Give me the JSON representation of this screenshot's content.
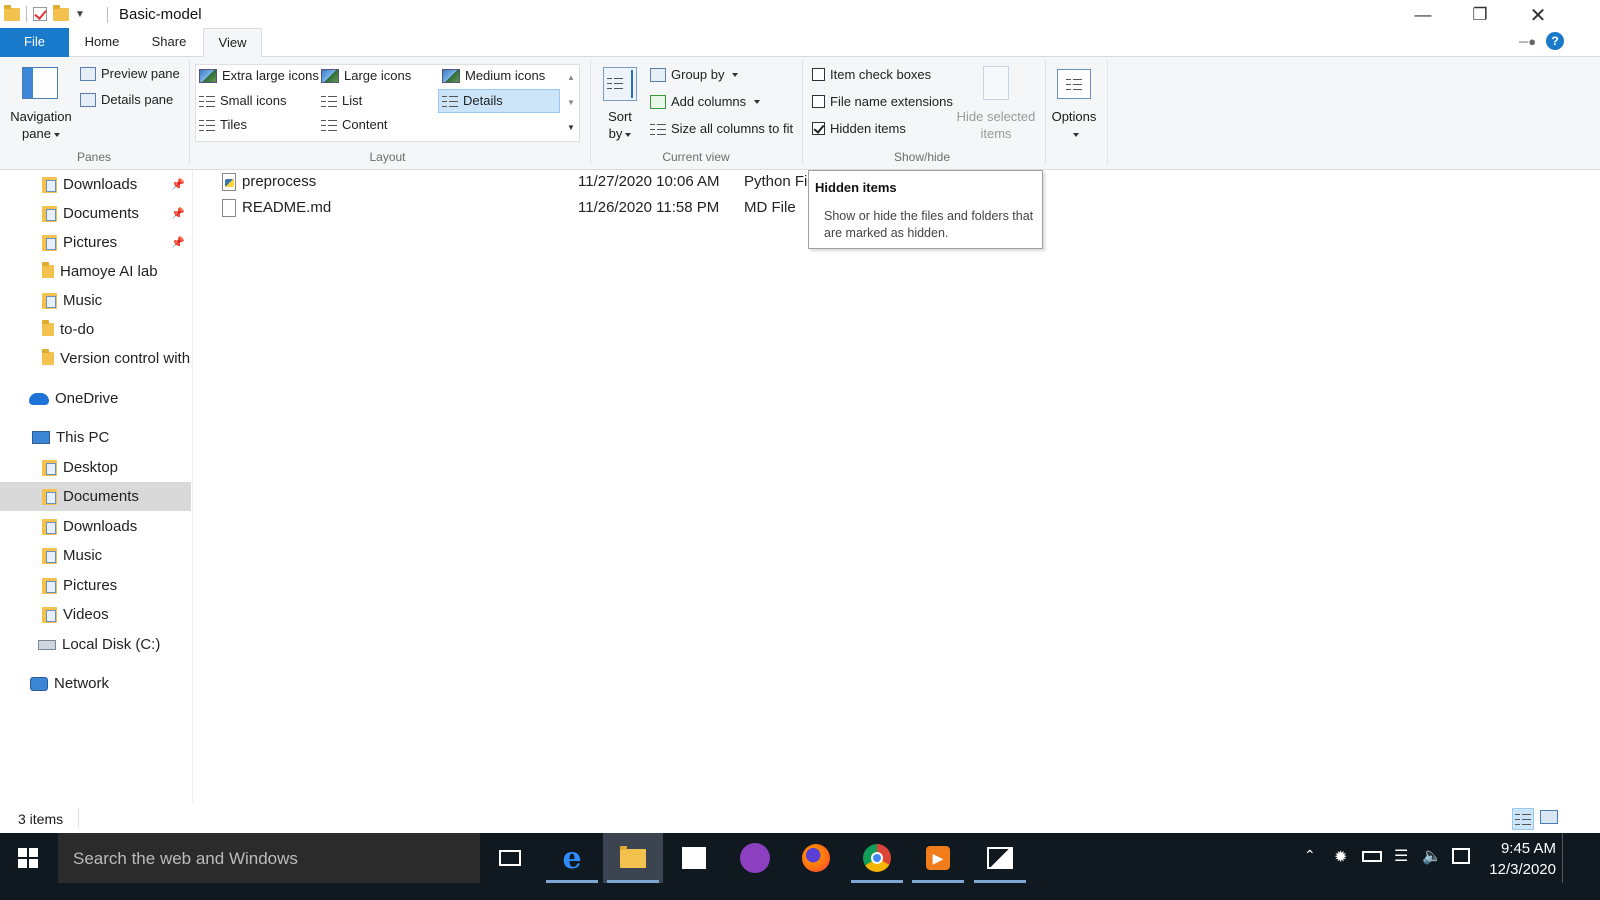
{
  "window": {
    "title": "Basic-model"
  },
  "ribbon_tabs": [
    "File",
    "Home",
    "Share",
    "View"
  ],
  "panes_group": {
    "navigation_pane": "Navigation",
    "navigation_pane_2": "pane",
    "preview_pane": "Preview pane",
    "details_pane": "Details pane",
    "label": "Panes"
  },
  "layout_group": {
    "items": [
      "Extra large icons",
      "Large icons",
      "Medium icons",
      "Small icons",
      "List",
      "Details",
      "Tiles",
      "Content"
    ],
    "selected": "Details",
    "label": "Layout"
  },
  "current_view_group": {
    "sort_by": "Sort",
    "sort_by_2": "by",
    "group_by": "Group by",
    "add_columns": "Add columns",
    "size_columns": "Size all columns to fit",
    "label": "Current view"
  },
  "show_hide_group": {
    "item_check_boxes": "Item check boxes",
    "item_check_boxes_checked": false,
    "file_name_extensions": "File name extensions",
    "file_name_extensions_checked": false,
    "hidden_items": "Hidden items",
    "hidden_items_checked": true,
    "hide_selected": "Hide selected",
    "hide_selected_2": "items",
    "label": "Show/hide"
  },
  "options": {
    "label": "Options"
  },
  "nav": {
    "quick_access": [
      {
        "label": "Downloads",
        "pinned": true
      },
      {
        "label": "Documents",
        "pinned": true
      },
      {
        "label": "Pictures",
        "pinned": true
      },
      {
        "label": "Hamoye AI lab",
        "pinned": false
      },
      {
        "label": "Music",
        "pinned": false
      },
      {
        "label": "to-do",
        "pinned": false
      },
      {
        "label": "Version control with",
        "pinned": false
      }
    ],
    "onedrive": "OneDrive",
    "this_pc": "This PC",
    "this_pc_items": [
      "Desktop",
      "Documents",
      "Downloads",
      "Music",
      "Pictures",
      "Videos",
      "Local Disk (C:)"
    ],
    "selected": "Documents",
    "network": "Network"
  },
  "files": [
    {
      "name": "preprocess",
      "date": "11/27/2020 10:06 AM",
      "type": "Python Fil"
    },
    {
      "name": "README.md",
      "date": "11/26/2020 11:58 PM",
      "type": "MD File"
    }
  ],
  "tooltip": {
    "title": "Hidden items",
    "body": "Show or hide the files and folders that are marked as hidden."
  },
  "status": {
    "items": "3 items"
  },
  "taskbar": {
    "search_placeholder": "Search the web and Windows",
    "time": "9:45 AM",
    "date": "12/3/2020"
  },
  "colors": {
    "file_tab": "#1979ca",
    "taskbar": "#101820",
    "selection": "#cce4f7"
  }
}
